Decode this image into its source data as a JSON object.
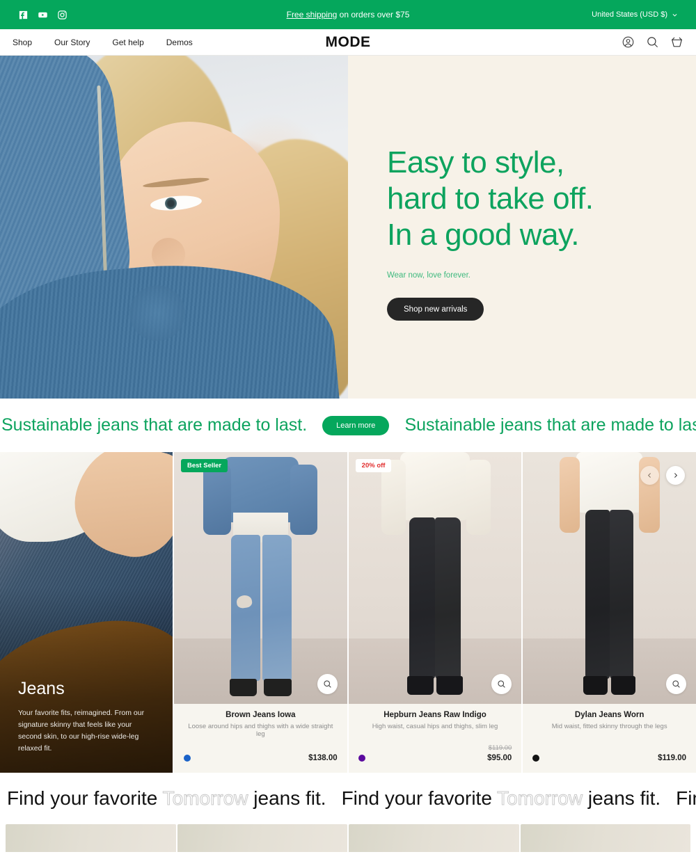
{
  "announcement": {
    "social": [
      {
        "name": "facebook-icon",
        "label": "Facebook"
      },
      {
        "name": "youtube-icon",
        "label": "YouTube"
      },
      {
        "name": "instagram-icon",
        "label": "Instagram"
      }
    ],
    "message_link": "Free shipping",
    "message_rest": " on orders over $75",
    "locale": "United States (USD  $)",
    "bg_color": "#05a75c"
  },
  "header": {
    "nav": [
      {
        "label": "Shop"
      },
      {
        "label": "Our Story"
      },
      {
        "label": "Get help"
      },
      {
        "label": "Demos"
      }
    ],
    "logo": "MODE",
    "icons": [
      {
        "name": "account-icon",
        "label": "Account"
      },
      {
        "name": "search-icon",
        "label": "Search"
      },
      {
        "name": "cart-icon",
        "label": "Cart"
      }
    ]
  },
  "hero": {
    "heading_lines": [
      "Easy to style,",
      "hard to take off.",
      "In a good way."
    ],
    "subheading": "Wear now, love forever.",
    "cta": "Shop new arrivals",
    "heading_color": "#0da35e",
    "panel_bg": "#f7f2e8"
  },
  "marquee_green": {
    "text": "Sustainable jeans that are made to last.",
    "button": "Learn more",
    "color": "#0da35e"
  },
  "collection": {
    "title": "Jeans",
    "description": "Your favorite fits, reimagined. From our signature skinny that feels like your second skin, to our high-rise wide-leg relaxed fit."
  },
  "products": [
    {
      "badge": "Best Seller",
      "badge_type": "best",
      "name": "Brown Jeans Iowa",
      "description": "Loose around hips and thighs with a wide straight leg",
      "price": "$138.00",
      "compare_at": "",
      "swatch": "#1a62c8",
      "quickview": "search-icon"
    },
    {
      "badge": "20% off",
      "badge_type": "sale",
      "name": "Hepburn Jeans Raw Indigo",
      "description": "High waist, casual hips and thighs, slim leg",
      "price": "$95.00",
      "compare_at": "$119.00",
      "swatch": "#5b0a9e",
      "quickview": "search-icon"
    },
    {
      "badge": "",
      "badge_type": "",
      "name": "Dylan Jeans Worn",
      "description": "Mid waist, fitted skinny through the legs",
      "price": "$119.00",
      "compare_at": "",
      "swatch": "#131313",
      "quickview": "search-icon"
    }
  ],
  "carousel": {
    "prev_label": "Previous",
    "next_label": "Next"
  },
  "marquee_black": {
    "before": "Find your favorite ",
    "outline": "Tomorrow",
    "after": " jeans fit."
  }
}
